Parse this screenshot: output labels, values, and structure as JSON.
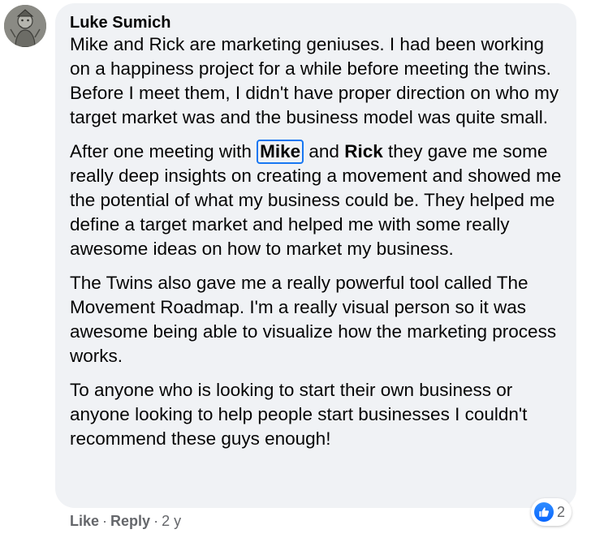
{
  "comment": {
    "author": "Luke Sumich",
    "paragraphs": {
      "p1": "Mike and Rick are marketing geniuses. I had been working on a happiness project for a while before meeting the twins. Before I meet them, I didn't have proper direction on who my target market was and the business model was quite small.",
      "p2_before": "After one meeting with ",
      "p2_mention1": "Mike",
      "p2_middle": " and ",
      "p2_mention2": "Rick",
      "p2_after": " they gave me some really deep insights on creating a movement and showed me the potential of what my business could be. They helped me define a target market and helped me with some really awesome ideas on how to market my business.",
      "p3": "The Twins also gave me a really powerful tool called The Movement Roadmap. I'm a really visual person so it was awesome being able to visualize how the marketing process works.",
      "p4": "To anyone who is looking to start their own business or anyone looking to help people start businesses I couldn't recommend these guys enough!"
    }
  },
  "actions": {
    "like_label": "Like",
    "separator": "·",
    "reply_label": "Reply",
    "timestamp": "2 y"
  },
  "reactions": {
    "icon": "like-icon",
    "count": "2"
  },
  "colors": {
    "bubble_bg": "#f0f2f5",
    "text": "#050505",
    "secondary_text": "#65676b",
    "accent": "#1877f2"
  }
}
